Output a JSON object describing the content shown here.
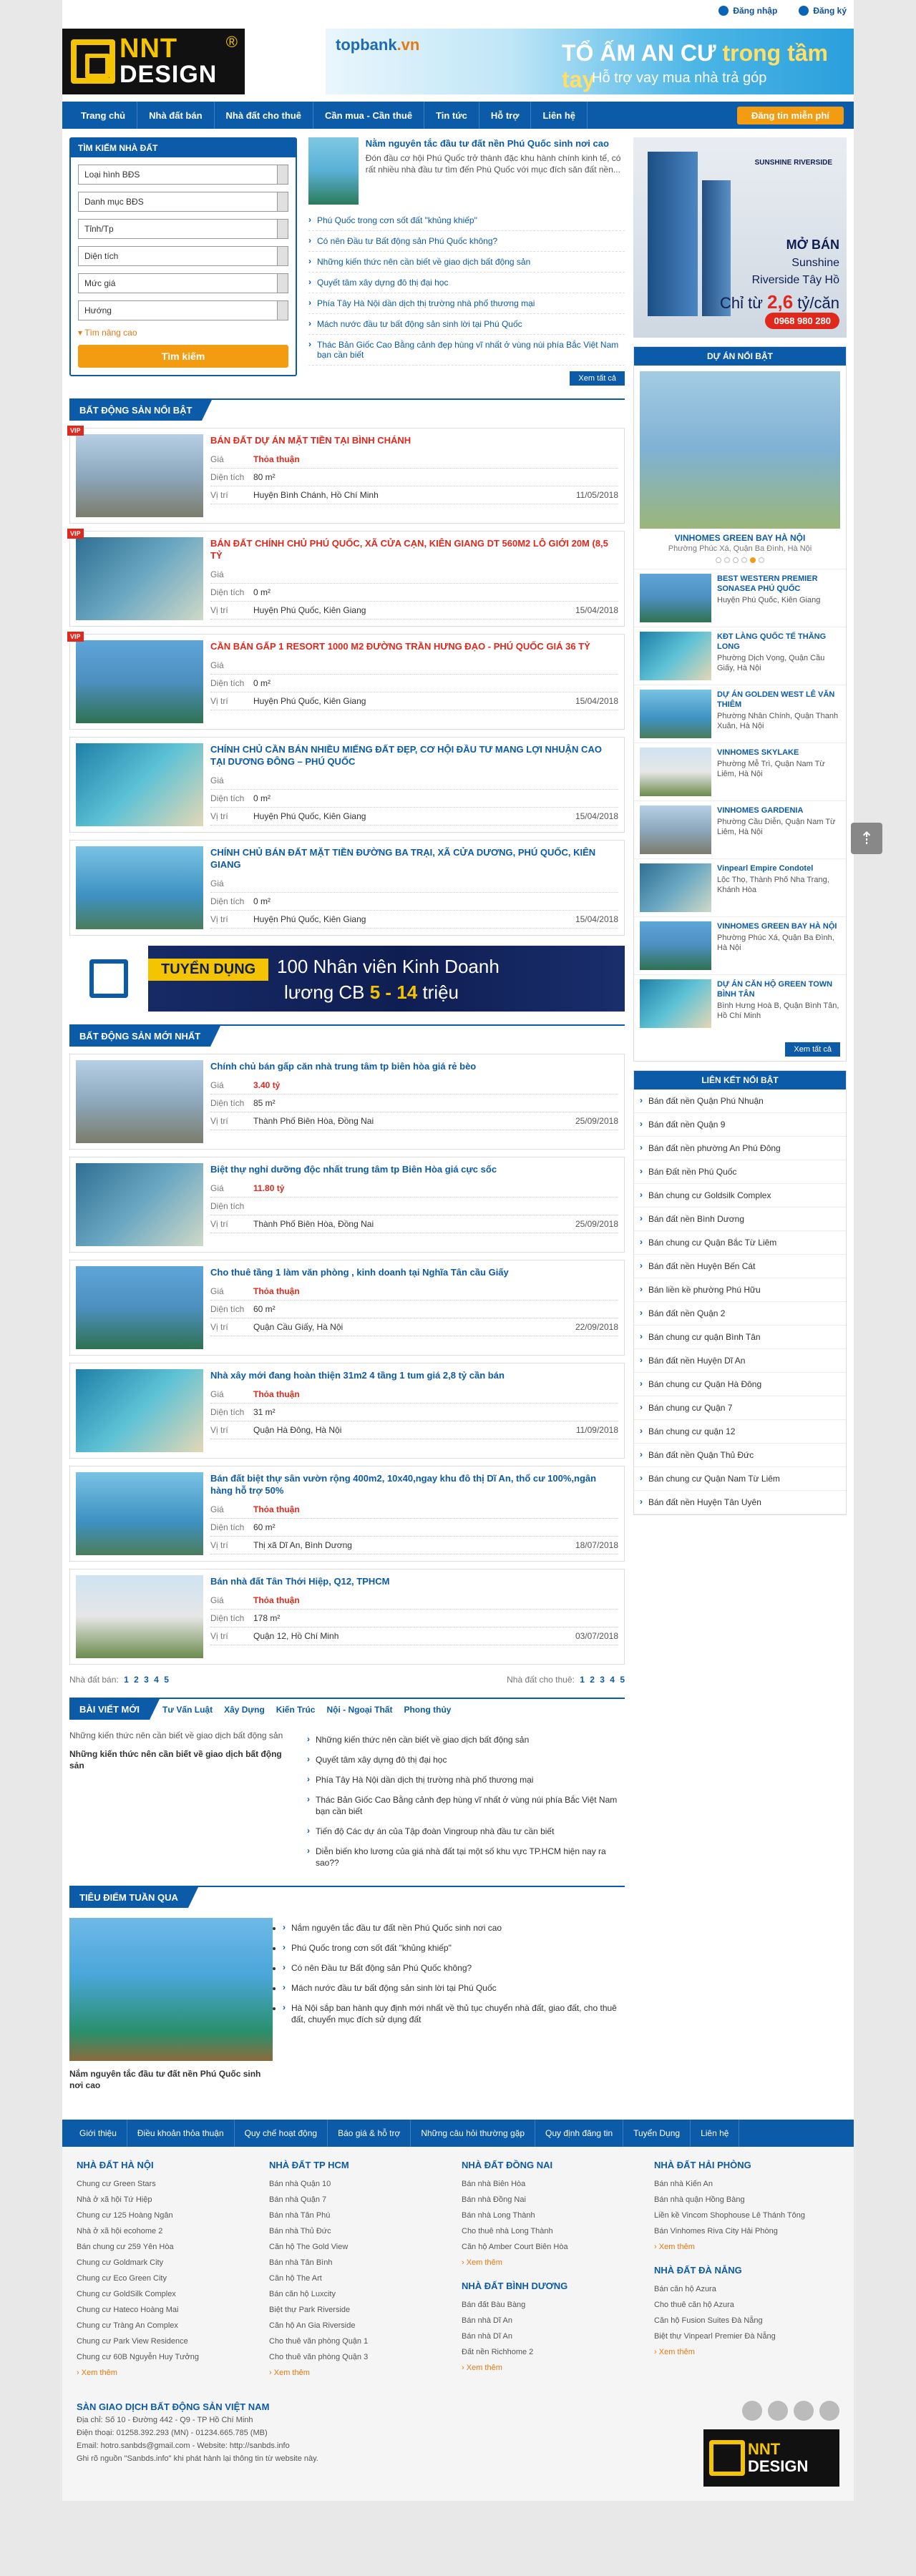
{
  "top": {
    "login": "Đăng nhập",
    "register": "Đăng ký"
  },
  "logo": {
    "line1": "NNT",
    "line2": "DESIGN",
    "reg": "®"
  },
  "banner": {
    "brand": "topbank",
    "brand2": ".vn",
    "t1": "TỔ ẤM AN CƯ",
    "t1b": " trong tầm tay",
    "t2": "Hỗ trợ vay mua nhà trả góp"
  },
  "nav": {
    "items": [
      "Trang chủ",
      "Nhà đất bán",
      "Nhà đất cho thuê",
      "Cần mua - Cần thuê",
      "Tin tức",
      "Hỗ trợ",
      "Liên hệ"
    ],
    "register": "Đăng tin miễn phí"
  },
  "search": {
    "title": "TÌM KIẾM NHÀ ĐẤT",
    "fields": [
      "Loại hình BĐS",
      "Danh mục BĐS",
      "Tỉnh/Tp",
      "Diện tích",
      "Mức giá",
      "Hướng"
    ],
    "advanced": "Tìm nâng cao",
    "button": "Tìm kiếm"
  },
  "news": {
    "top_title": "Nằm nguyên tắc đầu tư đất nền Phú Quốc sinh nơi cao",
    "top_desc": "Đón đầu cơ hội Phú Quốc trở thành đặc khu hành chính kinh tế, có rất nhiều nhà đầu tư tìm đến Phú Quốc với mục đích săn đất nền...",
    "items": [
      "Phú Quốc trong cơn sốt đất \"khủng khiếp\"",
      "Có nên Đầu tư Bất động sản Phú Quốc không?",
      "Những kiến thức nên cần biết về giao dịch bất động sản",
      "Quyết tâm xây dựng đô thị đại học",
      "Phía Tây Hà Nội dần dịch thị trường nhà phố thương mại",
      "Mách nước đầu tư bất động sản sinh lời tại Phú Quốc",
      "Thác Bản Giốc Cao Bằng cảnh đẹp hùng vĩ nhất ở vùng núi phía Bắc Việt Nam bạn cần biết"
    ],
    "more": "Xem tất cả"
  },
  "labels": {
    "price": "Giá",
    "area": "Diện tích",
    "loc": "Vị trí"
  },
  "section1": {
    "title": "BẤT ĐỘNG SẢN NỔI BẬT",
    "items": [
      {
        "title": "BÁN ĐẤT DỰ ÁN MẶT TIỀN TẠI BÌNH CHÁNH",
        "price": "Thỏa thuận",
        "area": "80 m²",
        "loc": "Huyện Bình Chánh, Hồ Chí Minh",
        "date": "11/05/2018"
      },
      {
        "title": "BÁN ĐẤT CHÍNH CHỦ PHÚ QUỐC, XÃ CỬA CẠN, KIÊN GIANG DT 560M2 LÔ GIỚI 20M (8,5 TỶ",
        "price": "",
        "area": "0 m²",
        "loc": "Huyện Phú Quốc, Kiên Giang",
        "date": "15/04/2018"
      },
      {
        "title": "CẦN BÁN GẤP 1 RESORT 1000 M2 ĐƯỜNG TRẦN HƯNG ĐẠO - PHÚ QUỐC GIÁ 36 TỶ",
        "price": "",
        "area": "0 m²",
        "loc": "Huyện Phú Quốc, Kiên Giang",
        "date": "15/04/2018"
      },
      {
        "title": "CHÍNH CHỦ CẦN BÁN NHIỀU MIẾNG ĐẤT ĐẸP, CƠ HỘI ĐẦU TƯ MANG LỢI NHUẬN CAO TẠI DƯƠNG ĐÔNG – PHÚ QUỐC",
        "price": "",
        "area": "0 m²",
        "loc": "Huyện Phú Quốc, Kiên Giang",
        "date": "15/04/2018"
      },
      {
        "title": "CHÍNH CHỦ BÁN ĐẤT MẶT TIỀN ĐƯỜNG BA TRẠI, XÃ CỬA DƯƠNG, PHÚ QUỐC, KIÊN GIANG",
        "price": "",
        "area": "0 m²",
        "loc": "Huyện Phú Quốc, Kiên Giang",
        "date": "15/04/2018"
      }
    ]
  },
  "recruit": {
    "t1": "TUYỂN DỤNG",
    "t2": "100 Nhân viên Kinh Doanh",
    "t3a": "lương CB ",
    "t3b": "5 - 14",
    "t3c": " triệu"
  },
  "section2": {
    "title": "BẤT ĐỘNG SẢN MỚI NHẤT",
    "items": [
      {
        "title": "Chính chủ bán gấp căn nhà trung tâm tp biên hòa giá rẻ bèo",
        "price": "3.40 tỷ",
        "area": "85 m²",
        "loc": "Thành Phố Biên Hòa, Đồng Nai",
        "date": "25/09/2018"
      },
      {
        "title": "Biệt thự nghỉ dưỡng độc nhất trung tâm tp Biên Hòa giá cực sốc",
        "price": "11.80 tỷ",
        "area": "",
        "loc": "Thành Phố Biên Hòa, Đồng Nai",
        "date": "25/09/2018"
      },
      {
        "title": "Cho thuê tầng 1 làm văn phòng , kinh doanh tại Nghĩa Tân cầu Giấy",
        "price": "Thỏa thuận",
        "area": "60 m²",
        "loc": "Quận Cầu Giấy, Hà Nội",
        "date": "22/09/2018"
      },
      {
        "title": "Nhà xây mới đang hoàn thiện 31m2 4 tầng 1 tum giá 2,8 tỷ cần bán",
        "price": "Thỏa thuận",
        "area": "31 m²",
        "loc": "Quận Hà Đông, Hà Nội",
        "date": "11/09/2018"
      },
      {
        "title": "Bán đất biệt thự sân vườn rộng 400m2, 10x40,ngay khu đô thị Dĩ An, thổ cư 100%,ngân hàng hỗ trợ 50%",
        "price": "Thỏa thuận",
        "area": "60 m²",
        "loc": "Thị xã Dĩ An, Bình Dương",
        "date": "18/07/2018"
      },
      {
        "title": "Bán nhà đất Tân Thới Hiệp, Q12, TPHCM",
        "price": "Thỏa thuận",
        "area": "178 m²",
        "loc": "Quận 12, Hồ Chí Minh",
        "date": "03/07/2018"
      }
    ]
  },
  "pager": {
    "left": "Nhà đất bán:",
    "right": "Nhà đất cho thuê:",
    "pages": [
      "1",
      "2",
      "3",
      "4",
      "5"
    ]
  },
  "blog": {
    "title": "BÀI VIẾT MỚI",
    "tabs": [
      "Tư Vấn Luật",
      "Xây Dựng",
      "Kiến Trúc",
      "Nội - Ngoại Thất",
      "Phong thủy"
    ],
    "lead1": "Những kiến thức nên cần biết về giao dịch bất động sản",
    "lead2": "Những kiến thức nên cần biết về giao dịch bất động sản",
    "items": [
      "Những kiến thức nên cần biết về giao dịch bất động sản",
      "Quyết tâm xây dựng đô thị đại học",
      "Phía Tây Hà Nội dần dịch thị trường nhà phố thương mại",
      "Thác Bản Giốc Cao Bằng cảnh đẹp hùng vĩ nhất ở vùng núi phía Bắc Việt Nam bạn cần biết",
      "Tiến độ Các dự án của Tập đoàn Vingroup nhà đầu tư cần biết",
      "Diễn biến kho lương của giá nhà đất tại một số khu vực TP.HCM hiện nay ra sao??"
    ]
  },
  "feature": {
    "title": "TIÊU ĐIỂM TUẦN QUA",
    "caption": "Nắm nguyên tắc đầu tư đất nền Phú Quốc sinh nơi cao",
    "items": [
      "Nắm nguyên tắc đầu tư đất nền Phú Quốc sinh nơi cao",
      "Phú Quốc trong cơn sốt đất \"khủng khiếp\"",
      "Có nên Đầu tư Bất động sản Phú Quốc không?",
      "Mách nước đầu tư bất động sản sinh lời tại Phú Quốc",
      "Hà Nội sắp ban hành quy định mới nhất về thủ tục chuyển nhà đất, giao đất, cho thuê đất, chuyển mục đích sử dụng đất"
    ]
  },
  "side": {
    "ad": {
      "a": "MỞ BÁN",
      "b": "Sunshine",
      "b2": "Riverside Tây Hồ",
      "c": "Chỉ từ ",
      "c2": "2,6",
      "c3": " tỷ/căn",
      "phone": "0968 980 280",
      "brand": "SUNSHINE RIVERSIDE"
    },
    "projects_title": "DỰ ÁN NỔI BẬT",
    "main": {
      "title": "VINHOMES GREEN BAY HÀ NỘI",
      "sub": "Phường Phúc Xá, Quận Ba Đình, Hà Nội"
    },
    "list": [
      {
        "title": "BEST WESTERN PREMIER SONASEA PHÚ QUỐC",
        "sub": "Huyện Phú Quốc, Kiên Giang"
      },
      {
        "title": "KĐT LÀNG QUỐC TẾ THĂNG LONG",
        "sub": "Phường Dịch Vọng, Quận Cầu Giấy, Hà Nội"
      },
      {
        "title": "DỰ ÁN GOLDEN WEST LÊ VĂN THIÊM",
        "sub": "Phường Nhân Chính, Quận Thanh Xuân, Hà Nội"
      },
      {
        "title": "VINHOMES SKYLAKE",
        "sub": "Phường Mễ Trì, Quận Nam Từ Liêm, Hà Nội"
      },
      {
        "title": "VINHOMES GARDENIA",
        "sub": "Phường Cầu Diễn, Quận Nam Từ Liêm, Hà Nội"
      },
      {
        "title": "Vinpearl Empire Condotel",
        "sub": "Lộc Thọ, Thành Phố Nha Trang, Khánh Hòa"
      },
      {
        "title": "VINHOMES GREEN BAY HÀ NỘI",
        "sub": "Phường Phúc Xá, Quận Ba Đình, Hà Nội"
      },
      {
        "title": "DỰ ÁN CĂN HỘ GREEN TOWN BÌNH TÂN",
        "sub": "Bình Hưng Hoà B, Quận Bình Tân, Hồ Chí Minh"
      }
    ],
    "more": "Xem tất cả",
    "links_title": "LIÊN KẾT NỔI BẬT",
    "links": [
      "Bán đất nền Quận Phú Nhuận",
      "Bán đất nền Quận 9",
      "Bán đất nền phường An Phú Đông",
      "Bán Đất nền Phú Quốc",
      "Bán chung cư Goldsilk Complex",
      "Bán đất nền Bình Dương",
      "Bán chung cư Quận Bắc Từ Liêm",
      "Bán đất nền Huyện Bến Cát",
      "Bán liền kề phường Phú Hữu",
      "Bán đất nền Quận 2",
      "Bán chung cư quận Bình Tân",
      "Bán đất nền Huyện Dĩ An",
      "Bán chung cư Quận Hà Đông",
      "Bán chung cư Quận 7",
      "Bán chung cư quận 12",
      "Bán đất nền Quận Thủ Đức",
      "Bán chung cư Quận Nam Từ Liêm",
      "Bán đất nền Huyện Tân Uyên"
    ]
  },
  "footnav": [
    "Giới thiệu",
    "Điều khoản thỏa thuận",
    "Quy chế hoạt động",
    "Báo giá & hỗ trợ",
    "Những câu hỏi thường gặp",
    "Quy định đăng tin",
    "Tuyển Dụng",
    "Liên hệ"
  ],
  "footer": {
    "cols": [
      {
        "title": "NHÀ ĐẤT HÀ NỘI",
        "items": [
          "Chung cư Green Stars",
          "Nhà ở xã hội Tứ Hiệp",
          "Chung cư 125 Hoàng Ngân",
          "Nhà ở xã hội ecohome 2",
          "Bán chung cư 259 Yên Hòa",
          "Chung cư Goldmark City",
          "Chung cư Eco Green City",
          "Chung cư GoldSilk Complex",
          "Chung cư Hateco Hoàng Mai",
          "Chung cư Tràng An Complex",
          "Chung cư Park View Residence",
          "Chung cư 60B Nguyễn Huy Tưởng"
        ]
      },
      {
        "title": "NHÀ ĐẤT TP HCM",
        "items": [
          "Bán nhà Quận 10",
          "Bán nhà Quận 7",
          "Bán nhà Tân Phú",
          "Bán nhà Thủ Đức",
          "Căn hộ The Gold View",
          "Bán nhà Tân Bình",
          "Căn hộ The Art",
          "Bán căn hộ Luxcity",
          "Biệt thự Park Riverside",
          "Căn hộ An Gia Riverside",
          "Cho thuê văn phòng Quận 1",
          "Cho thuê văn phòng Quận 3"
        ]
      },
      {
        "title": "NHÀ ĐẤT ĐỒNG NAI",
        "items": [
          "Bán nhà Biên Hòa",
          "Bán nhà Đồng Nai",
          "Bán nhà Long Thành",
          "Cho thuê nhà Long Thành",
          "Căn hộ Amber Court Biên Hòa"
        ],
        "title2": "NHÀ ĐẤT BÌNH DƯƠNG",
        "items2": [
          "Bán đất Bàu Bàng",
          "Bán nhà Dĩ An",
          "Bán nhà Dĩ An",
          "Đất nền Richhome 2"
        ]
      },
      {
        "title": "NHÀ ĐẤT HẢI PHÒNG",
        "items": [
          "Bán nhà Kiến An",
          "Bán nhà quận Hồng Bàng",
          "Liền kề Vincom Shophouse Lê Thánh Tông",
          "Bán Vinhomes Riva City Hải Phòng"
        ],
        "title2": "NHÀ ĐẤT ĐÀ NẴNG",
        "items2": [
          "Bán căn hộ Azura",
          "Cho thuê căn hộ Azura",
          "Căn hộ Fusion Suites Đà Nẵng",
          "Biệt thự Vinpearl Premier Đà Nẵng"
        ]
      }
    ],
    "more": "Xem thêm"
  },
  "bottom": {
    "title": "SÀN GIAO DỊCH BẤT ĐỘNG SẢN VIỆT NAM",
    "addr": "Địa chỉ: Số 10 - Đường 442 - Q9 - TP Hồ Chí Minh",
    "phone": "Điện thoại: 01258.392.293 (MN) - 01234.665.785 (MB)",
    "email": "Email: hotro.sanbds@gmail.com - Website: http://sanbds.info",
    "note": "Ghi rõ nguồn \"Sanbds.info\" khi phát hành lại thông tin từ website này."
  }
}
